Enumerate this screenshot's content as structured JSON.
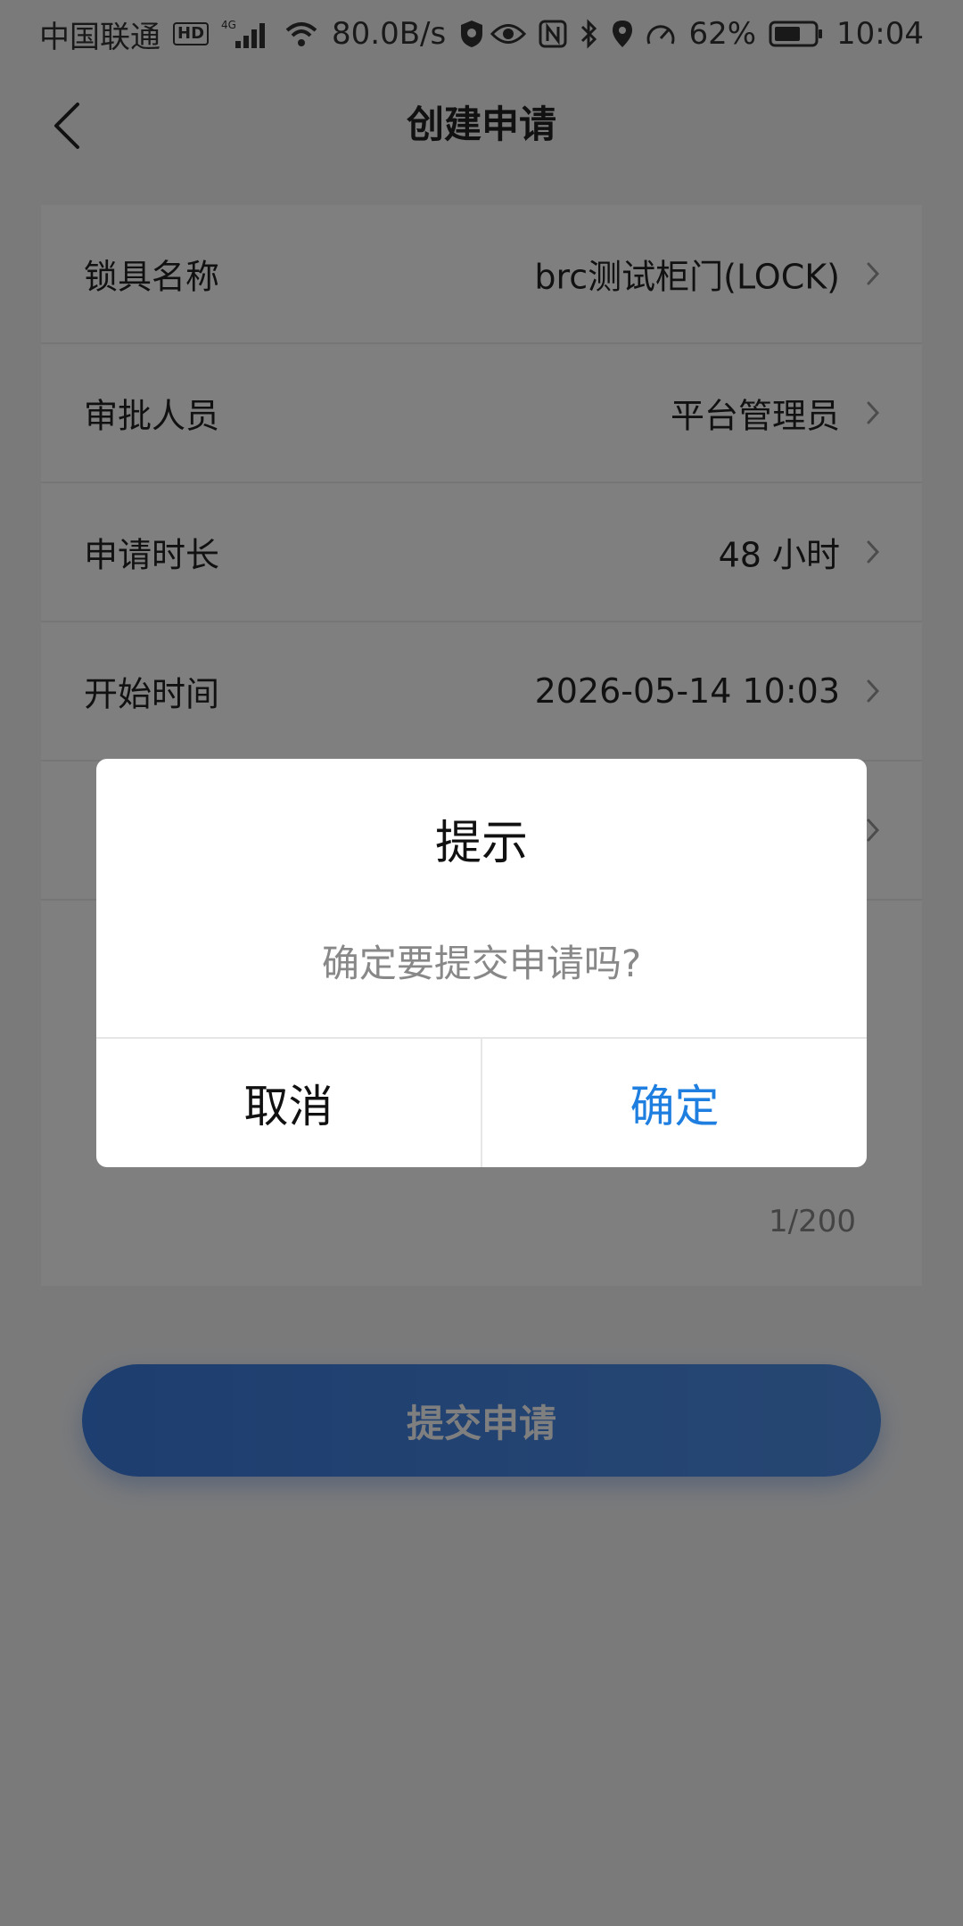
{
  "status_bar": {
    "carrier": "中国联通",
    "hd_badge": "HD",
    "network_type": "4G",
    "speed": "80.0B/s",
    "battery": "62%",
    "time": "10:04",
    "icons": [
      "hd-icon",
      "signal-icon",
      "wifi-icon",
      "vpn-shield-icon",
      "eye-icon",
      "nfc-icon",
      "bluetooth-icon",
      "location-icon",
      "speedometer-icon",
      "battery-icon"
    ]
  },
  "nav": {
    "title": "创建申请",
    "back_icon": "back-chevron-icon"
  },
  "form": {
    "rows": [
      {
        "label": "锁具名称",
        "value": "brc测试柜门(LOCK)"
      },
      {
        "label": "审批人员",
        "value": "平台管理员"
      },
      {
        "label": "申请时长",
        "value": "48 小时"
      },
      {
        "label": "开始时间",
        "value": "2026-05-14 10:03"
      },
      {
        "label": "",
        "value": ""
      }
    ],
    "reason_label": "",
    "char_count": "1/200"
  },
  "submit_button": {
    "label": "提交申请"
  },
  "dialog": {
    "title": "提示",
    "message": "确定要提交申请吗?",
    "cancel_label": "取消",
    "confirm_label": "确定"
  },
  "colors": {
    "accent": "#1f7fe0",
    "button_gradient_start": "#3b7ce0",
    "button_gradient_end": "#4f8ee6",
    "overlay": "rgba(0,0,0,0.5)"
  }
}
